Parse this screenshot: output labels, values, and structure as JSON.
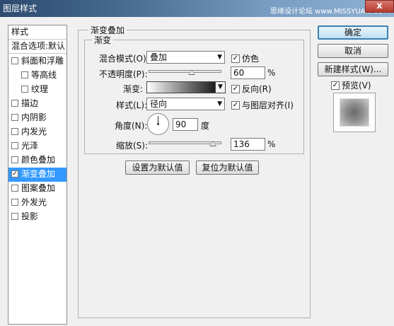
{
  "window": {
    "title": "图层样式",
    "watermark": "思缘设计论坛 www.MISSYUAN.COM",
    "close_label": "x"
  },
  "sidebar": {
    "header_label": "样式",
    "blend_options_label": "混合选项:默认",
    "items": [
      {
        "label": "斜面和浮雕",
        "checked": false
      },
      {
        "label": "等高线",
        "checked": false
      },
      {
        "label": "纹理",
        "checked": false
      },
      {
        "label": "描边",
        "checked": false
      },
      {
        "label": "内阴影",
        "checked": false
      },
      {
        "label": "内发光",
        "checked": false
      },
      {
        "label": "光泽",
        "checked": false
      },
      {
        "label": "颜色叠加",
        "checked": false
      },
      {
        "label": "渐变叠加",
        "checked": true
      },
      {
        "label": "图案叠加",
        "checked": false
      },
      {
        "label": "外发光",
        "checked": false
      },
      {
        "label": "投影",
        "checked": false
      }
    ]
  },
  "panel": {
    "group_title": "渐变叠加",
    "inner_title": "渐变",
    "blend_mode_label": "混合模式(O):",
    "blend_mode_value": "叠加",
    "dither_label": "仿色",
    "dither_checked": true,
    "opacity_label": "不透明度(P):",
    "opacity_value": "60",
    "opacity_unit": "%",
    "gradient_label": "渐变:",
    "reverse_label": "反向(R)",
    "reverse_checked": true,
    "style_label": "样式(L):",
    "style_value": "径向",
    "align_label": "与图层对齐(I)",
    "align_checked": true,
    "angle_label": "角度(N):",
    "angle_value": "90",
    "angle_unit": "度",
    "scale_label": "缩放(S):",
    "scale_value": "136",
    "scale_unit": "%",
    "make_default_label": "设置为默认值",
    "reset_default_label": "复位为默认值"
  },
  "actions": {
    "ok_label": "确定",
    "cancel_label": "取消",
    "new_style_label": "新建样式(W)...",
    "preview_label": "预览(V)",
    "preview_checked": true
  },
  "colors": {
    "selected_row": "#3399ff",
    "title_bar": "#4c6f96"
  }
}
